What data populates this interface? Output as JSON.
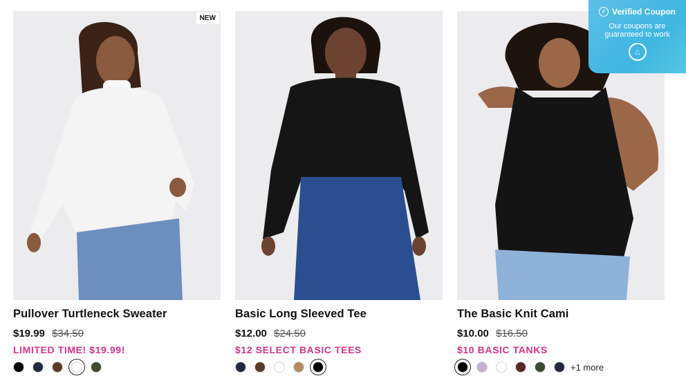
{
  "products": [
    {
      "title": "Pullover Turtleneck Sweater",
      "badge": "NEW",
      "price": "$19.99",
      "was": "$34.50",
      "promo": "LIMITED TIME! $19.99!",
      "swatches": [
        "#000000",
        "#232a3d",
        "#5b3a26",
        "#ffffff",
        "#3f4a36"
      ],
      "selected_swatch": 3,
      "more": ""
    },
    {
      "title": "Basic Long Sleeved Tee",
      "badge": "",
      "price": "$12.00",
      "was": "$24.50",
      "promo": "$12 SELECT BASIC TEES",
      "swatches": [
        "#232a3d",
        "#5b3a26",
        "#ffffff",
        "#b38a62",
        "#000000"
      ],
      "selected_swatch": 4,
      "more": ""
    },
    {
      "title": "The Basic Knit Cami",
      "badge": "",
      "price": "$10.00",
      "was": "$16.50",
      "promo": "$10 BASIC TANKS",
      "swatches": [
        "#000000",
        "#c6b2cf",
        "#ffffff",
        "#5a2623",
        "#3f4a36",
        "#232a3d"
      ],
      "selected_swatch": 0,
      "more": "+1 more"
    }
  ],
  "coupon": {
    "title": "Verified Coupon",
    "subtitle_line1": "Our coupons are",
    "subtitle_line2": "guaranteed to work"
  }
}
